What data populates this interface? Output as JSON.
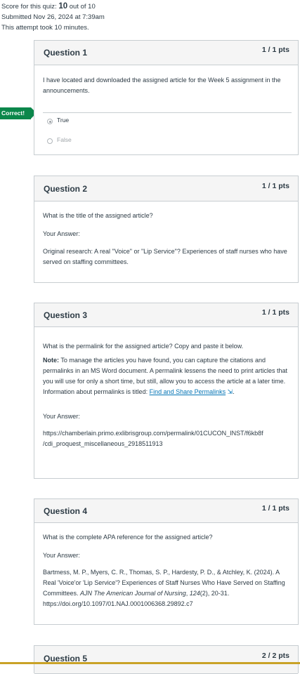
{
  "summary": {
    "score_prefix": "Score for this quiz: ",
    "score_value": "10",
    "score_suffix": " out of 10",
    "submitted": "Submitted Nov 26, 2024 at 7:39am",
    "duration": "This attempt took 10 minutes."
  },
  "correct_flag": "Correct!",
  "questions": [
    {
      "title": "Question 1",
      "pts": "1 / 1 pts",
      "text": "I have located and downloaded the assigned article for the Week 5 assignment in the announcements.",
      "options": [
        {
          "label": "True",
          "selected": true
        },
        {
          "label": "False",
          "selected": false
        }
      ]
    },
    {
      "title": "Question 2",
      "pts": "1 / 1 pts",
      "text": "What is the title of the assigned article?",
      "answer_label": "Your Answer:",
      "answer": "Original research: A real \"Voice\" or \"Lip Service\"? Experiences of staff nurses who have served on staffing committees."
    },
    {
      "title": "Question 3",
      "pts": "1 / 1 pts",
      "text": "What is the permalink for the assigned article? Copy and paste it below.",
      "note_label": "Note:",
      "note": " To manage the articles you have found, you can capture the citations and permalinks in an MS Word document. A permalink lessens the need to print articles that you will use for only a short time, but still, allow you to access the article at a later time. Information about permalinks is titled: ",
      "link_text": "Find and Share Permalinks",
      "answer_label": "Your Answer:",
      "answer_line1": "https://chamberlain.primo.exlibrisgroup.com/permalink/01CUCON_INST/f6kb8f",
      "answer_line2": "/cdi_proquest_miscellaneous_2918511913"
    },
    {
      "title": "Question 4",
      "pts": "1 / 1 pts",
      "text": "What is the complete APA reference for the assigned article?",
      "answer_label": "Your Answer:",
      "answer_part1": "Bartmess, M. P., Myers, C. R., Thomas, S. P., Hardesty, P. D., & Atchley, K. (2024). A Real 'Voice'or 'Lip Service'? Experiences of Staff Nurses Who Have Served on Staffing Committees. ",
      "answer_journal": "AJN The American Journal of Nursing",
      "answer_part2": ", ",
      "answer_volume": "124",
      "answer_part3": "(2), 20-31. https://doi.org/10.1097/01.NAJ.0001006368.29892.c7"
    },
    {
      "title": "Question 5",
      "pts": "2 / 2 pts"
    }
  ]
}
